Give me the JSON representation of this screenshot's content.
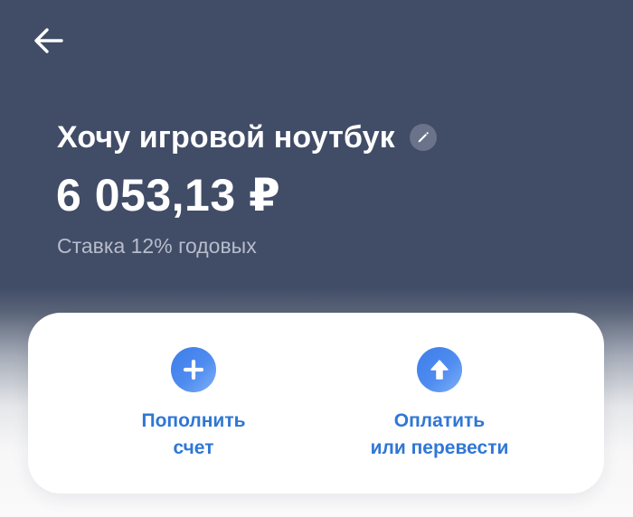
{
  "header": {
    "back_icon": "arrow-left-icon",
    "background_color": "#414c67"
  },
  "account": {
    "title": "Хочу игровой ноутбук",
    "edit_icon": "pencil-icon",
    "balance": "6 053,13 ₽",
    "rate": "Ставка 12% годовых"
  },
  "actions": {
    "topup": {
      "icon": "plus-icon",
      "line1": "Пополнить",
      "line2": "счет"
    },
    "pay": {
      "icon": "arrow-up-icon",
      "line1": "Оплатить",
      "line2": "или перевести"
    },
    "accent_color": "#2f77d6"
  }
}
